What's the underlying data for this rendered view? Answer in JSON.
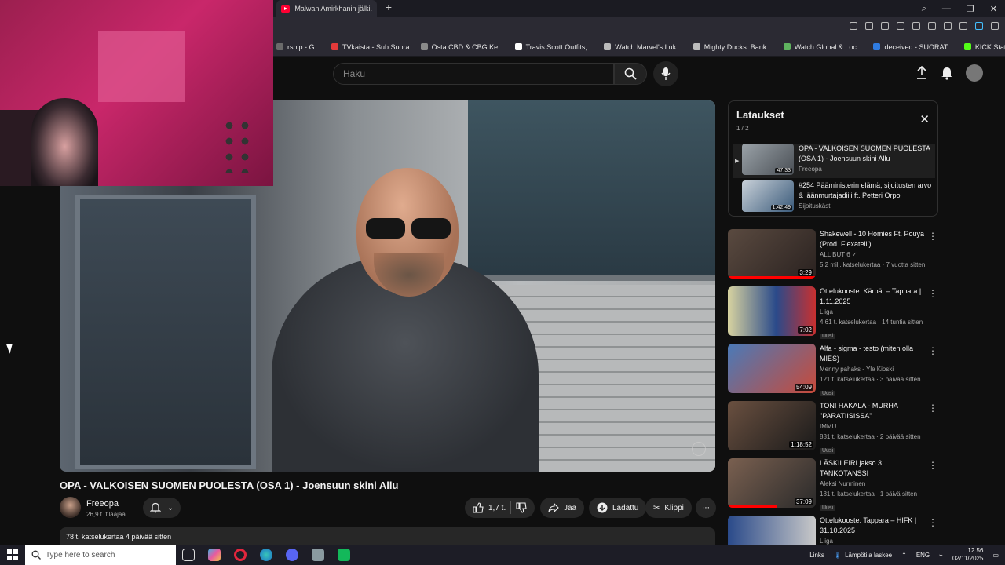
{
  "browser": {
    "tab_title": "Malwan Amirkhanin jälki...",
    "new_tab_symbol": "+",
    "bookmarks": [
      {
        "label": "rship - G...",
        "color": "#6a6a6a"
      },
      {
        "label": "TVkaista - Sub Suora",
        "color": "#e33a3a"
      },
      {
        "label": "Osta CBD & CBG Ke...",
        "color": "#8a8a8a"
      },
      {
        "label": "Travis Scott Outfits,...",
        "color": "#ffffff"
      },
      {
        "label": "Watch Marvel's Luk...",
        "color": "#bbbbbb"
      },
      {
        "label": "Mighty Ducks: Bank...",
        "color": "#bbbbbb"
      },
      {
        "label": "Watch Global & Loc...",
        "color": "#5fb35f"
      },
      {
        "label": "deceived - SUORAT...",
        "color": "#2f7be0"
      },
      {
        "label": "KICK Status Page",
        "color": "#53fc18"
      }
    ]
  },
  "header": {
    "search_placeholder": "Haku"
  },
  "video": {
    "title": "OPA - VALKOISEN SUOMEN PUOLESTA (OSA 1) - Joensuun skini Allu",
    "channel": "Freeopa",
    "subscribers": "26,9 t. tilaajaa",
    "likes": "1,7 t.",
    "share_label": "Jaa",
    "download_label": "Ladattu",
    "clip_label": "Klippi",
    "description": "78 t. katselukertaa  4 päivää sitten"
  },
  "playlist": {
    "title": "Lataukset",
    "count": "1 / 2",
    "items": [
      {
        "title": "OPA - VALKOISEN SUOMEN PUOLESTA (OSA 1) - Joensuun skini Allu",
        "channel": "Freeopa",
        "duration": "47:33",
        "active": true
      },
      {
        "title": "#254 Pääministerin elämä, sijoitusten arvo & jäänmurtajadiili ft. Petteri Orpo",
        "channel": "Sijoituskästi",
        "duration": "1:42:49",
        "active": false
      }
    ]
  },
  "recommendations": [
    {
      "title": "Shakewell - 10 Homies Ft. Pouya (Prod. Flexatelli)",
      "channel": "ALL BUT 6 ✓",
      "meta": "5,2 milj. katselukertaa · 7 vuotta sitten",
      "duration": "3:29",
      "badge": "",
      "progress": 1.0
    },
    {
      "title": "Ottelukooste: Kärpät – Tappara | 1.11.2025",
      "channel": "Liiga",
      "meta": "4,61 t. katselukertaa · 14 tuntia sitten",
      "duration": "7:02",
      "badge": "Uusi",
      "progress": 0
    },
    {
      "title": "Alfa - sigma - testo (miten olla MIES)",
      "channel": "Menny pahaks - Yle Kioski",
      "meta": "121 t. katselukertaa · 3 päivää sitten",
      "duration": "54:09",
      "badge": "Uusi",
      "progress": 0
    },
    {
      "title": "TONI HAKALA - MURHA \"PARATIISISSA\"",
      "channel": "IMMU",
      "meta": "881 t. katselukertaa · 2 päivää sitten",
      "duration": "1:18:52",
      "badge": "Uusi",
      "progress": 0
    },
    {
      "title": "LÄSKILEIRI jakso 3 TANKOTANSSI",
      "channel": "Aleksi Nurminen",
      "meta": "181 t. katselukertaa · 1 päivä sitten",
      "duration": "37:09",
      "badge": "Uusi",
      "progress": 0.55
    },
    {
      "title": "Ottelukooste: Tappara – HIFK | 31.10.2025",
      "channel": "Liiga",
      "meta": "",
      "duration": "",
      "badge": "",
      "progress": 0
    }
  ],
  "taskbar": {
    "search_placeholder": "Type here to search",
    "links_label": "Links",
    "weather": "Lämpötila laskee",
    "language": "ENG",
    "time": "12.56",
    "date": "02/11/2025"
  }
}
